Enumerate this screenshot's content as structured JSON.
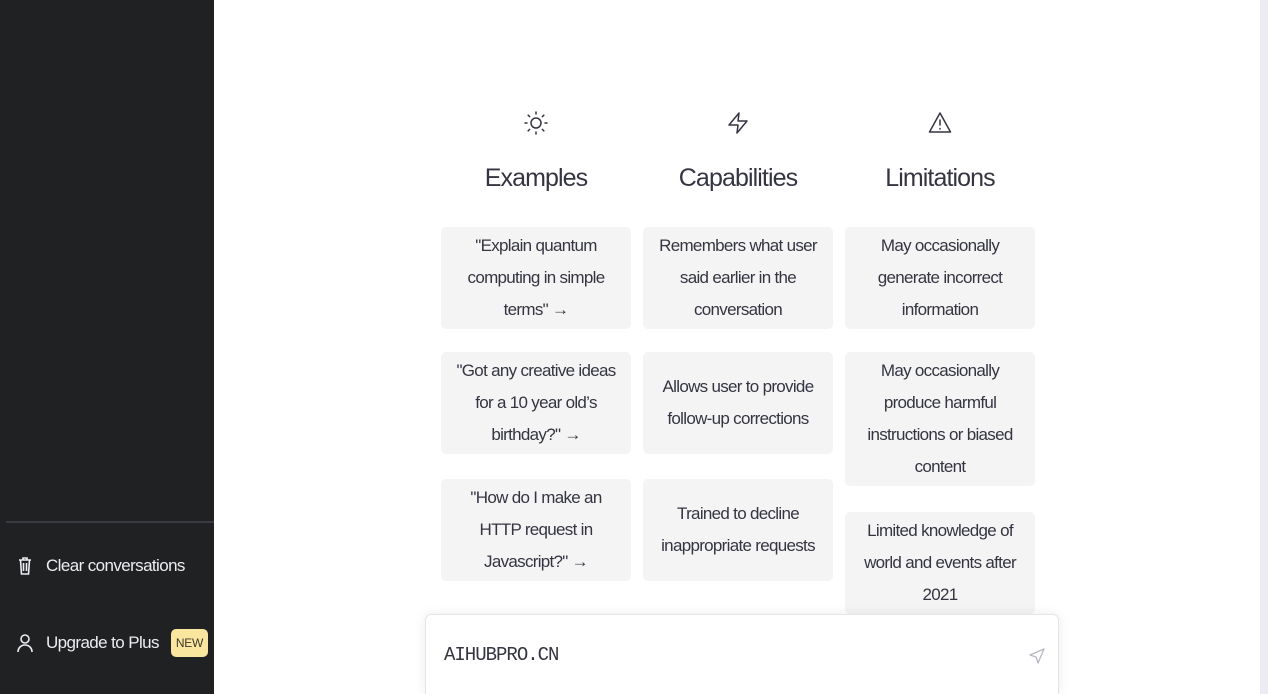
{
  "sidebar": {
    "clear_label": "Clear conversations",
    "upgrade_label": "Upgrade to Plus",
    "new_badge": "NEW"
  },
  "columns": [
    {
      "title": "Examples",
      "icon": "sun-icon",
      "cards": [
        "\"Explain quantum computing in simple terms\" →",
        "\"Got any creative ideas for a 10 year old’s birthday?\" →",
        "\"How do I make an HTTP request in Javascript?\" →"
      ]
    },
    {
      "title": "Capabilities",
      "icon": "lightning-icon",
      "cards": [
        "Remembers what user said earlier in the conversation",
        "Allows user to provide follow-up corrections",
        "Trained to decline inappropriate requests"
      ]
    },
    {
      "title": "Limitations",
      "icon": "warning-icon",
      "cards": [
        "May occasionally generate incorrect information",
        "May occasionally produce harmful instructions or biased content",
        "Limited knowledge of world and events after 2021"
      ]
    }
  ],
  "input": {
    "value": "AIHUBPRO.CN"
  },
  "colors": {
    "sidebar_bg": "#202123",
    "card_bg": "#f4f4f5",
    "badge_bg": "#fae69e"
  }
}
